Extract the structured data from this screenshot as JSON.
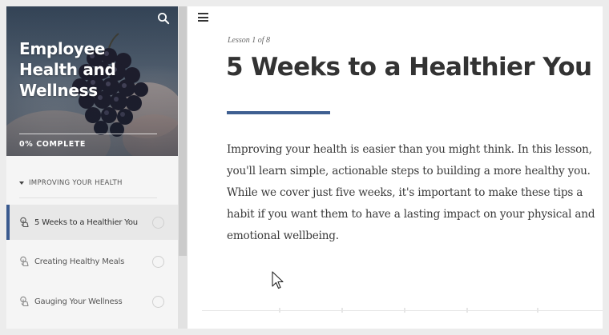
{
  "sidebar": {
    "course_title": "Employee Health and Wellness",
    "progress": {
      "label": "0% COMPLETE",
      "percent": 0
    },
    "section": {
      "label": "IMPROVING YOUR HEALTH",
      "expanded": true
    },
    "lessons": [
      {
        "label": "5 Weeks to a Healthier You",
        "active": true,
        "completed": false
      },
      {
        "label": "Creating Healthy Meals",
        "active": false,
        "completed": false
      },
      {
        "label": "Gauging Your Wellness",
        "active": false,
        "completed": false
      }
    ]
  },
  "main": {
    "lesson_counter": "Lesson 1 of 8",
    "title": "5 Weeks to a Healthier You",
    "body": "Improving your health is easier than you might think. In this lesson, you'll learn simple, actionable steps to building a more healthy you. While we cover just five weeks, it's important to make these tips a habit if you want them to have a lasting impact on your physical and emotional wellbeing."
  },
  "icons": {
    "search": "search-icon",
    "menu": "hamburger-menu-icon",
    "lesson": "lesson-touch-icon",
    "status": "incomplete-status-circle"
  },
  "colors": {
    "accent": "#3f5f91",
    "sidebar_bg": "#f5f5f5",
    "active_row_bg": "#e8e8e8",
    "text": "#333333"
  }
}
